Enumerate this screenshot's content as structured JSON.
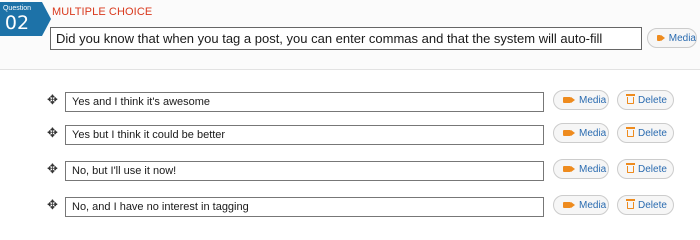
{
  "question": {
    "label": "Question",
    "number": "02",
    "type_label": "MULTIPLE CHOICE",
    "text": "Did you know that when you tag a post, you can enter commas and that the system will auto-fill",
    "media_label": "Media"
  },
  "answers": [
    {
      "text": "Yes and I think it's awesome",
      "media_label": "Media",
      "delete_label": "Delete"
    },
    {
      "text": "Yes but I think it could be better",
      "media_label": "Media",
      "delete_label": "Delete"
    },
    {
      "text": "No, but I'll use it now!",
      "media_label": "Media",
      "delete_label": "Delete"
    },
    {
      "text": "No, and I have no interest in tagging",
      "media_label": "Media",
      "delete_label": "Delete"
    }
  ],
  "icons": {
    "move": "move-icon",
    "media": "camera-icon",
    "delete": "trash-icon"
  },
  "colors": {
    "badge": "#1d72a8",
    "type_label": "#d9391d",
    "icon_accent": "#ee8b1e",
    "button_text": "#2a6bb0"
  }
}
